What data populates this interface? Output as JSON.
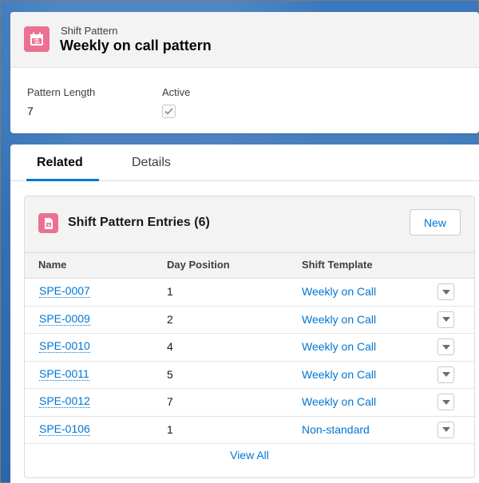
{
  "header": {
    "object_type": "Shift Pattern",
    "record_title": "Weekly on call pattern",
    "icon": "calendar-icon",
    "icon_color": "#eb7092",
    "fields": {
      "pattern_length_label": "Pattern Length",
      "pattern_length_value": "7",
      "active_label": "Active",
      "active_checked": true
    }
  },
  "tabs": [
    {
      "label": "Related",
      "active": true
    },
    {
      "label": "Details",
      "active": false
    }
  ],
  "related": {
    "title": "Shift Pattern Entries (6)",
    "icon": "document-icon",
    "new_button_label": "New",
    "columns": [
      "Name",
      "Day Position",
      "Shift Template"
    ],
    "rows": [
      {
        "name": "SPE-0007",
        "day": "1",
        "template": "Weekly on Call"
      },
      {
        "name": "SPE-0009",
        "day": "2",
        "template": "Weekly on Call"
      },
      {
        "name": "SPE-0010",
        "day": "4",
        "template": "Weekly on Call"
      },
      {
        "name": "SPE-0011",
        "day": "5",
        "template": "Weekly on Call"
      },
      {
        "name": "SPE-0012",
        "day": "7",
        "template": "Weekly on Call"
      },
      {
        "name": "SPE-0106",
        "day": "1",
        "template": "Non-standard"
      }
    ],
    "view_all_label": "View All"
  },
  "colors": {
    "link": "#0176d3",
    "accent_tab": "#0176d3",
    "icon_pink": "#eb7092"
  }
}
